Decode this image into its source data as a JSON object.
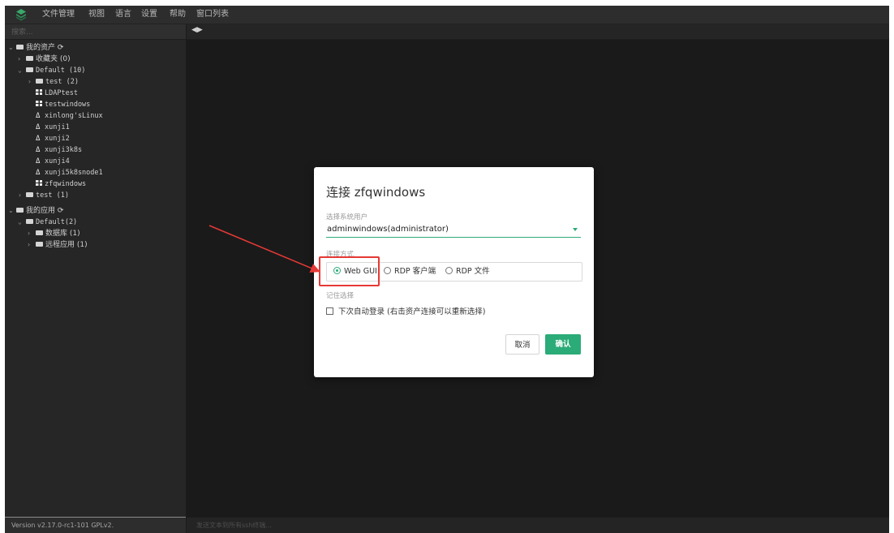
{
  "menu": [
    "文件管理",
    "视图",
    "语言",
    "设置",
    "帮助",
    "窗口列表"
  ],
  "search": {
    "placeholder": "搜索..."
  },
  "tree": {
    "my_assets": "我的资产",
    "favorites": "收藏夹 (0)",
    "default_group": "Default (10)",
    "test_sub": "test (2)",
    "hosts": [
      "LDAPtest",
      "testwindows",
      "xinlong'sLinux",
      "xunji1",
      "xunji2",
      "xunji3k8s",
      "xunji4",
      "xunji5k8snode1",
      "zfqwindows"
    ],
    "test_group": "test (1)",
    "my_apps": "我的应用",
    "default_apps": "Default(2)",
    "database": "数据库 (1)",
    "remote_app": "远程应用 (1)"
  },
  "version": "Version v2.17.0-rc1-101 GPLv2.",
  "cmdbar_placeholder": "发送文本到所有ssh终端...",
  "dialog": {
    "title": "连接 zfqwindows",
    "user_label": "选择系统用户",
    "user_value": "adminwindows(administrator)",
    "method_label": "连接方式",
    "options": [
      "Web GUI",
      "RDP 客户端",
      "RDP 文件"
    ],
    "selected_option": "Web GUI",
    "remember_label": "记住选择",
    "auto_login": "下次自动登录 (右击资产连接可以重新选择)",
    "cancel": "取消",
    "confirm": "确认"
  },
  "colors": {
    "accent": "#2bab77",
    "annotation": "#e53935"
  }
}
